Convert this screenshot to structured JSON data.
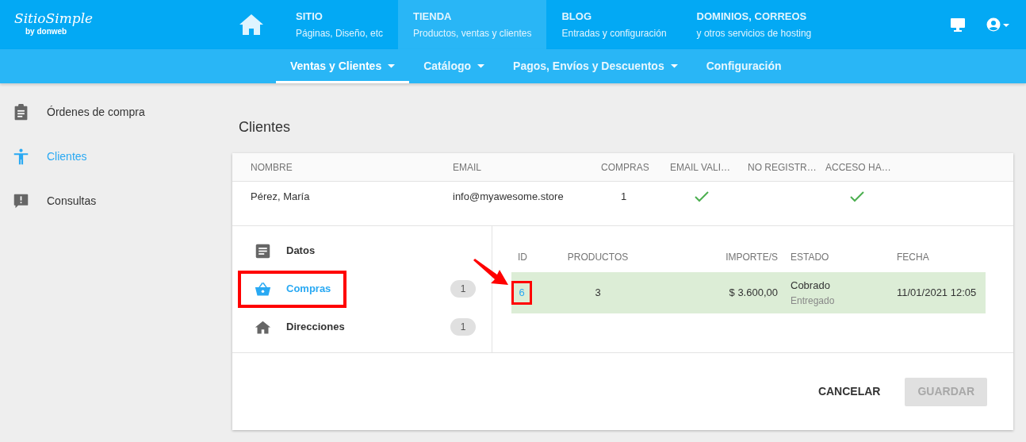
{
  "brand": {
    "name": "SitioSimple",
    "tagline": "by donweb"
  },
  "main_nav": [
    {
      "title": "SITIO",
      "subtitle": "Páginas, Diseño, etc",
      "selected": false
    },
    {
      "title": "TIENDA",
      "subtitle": "Productos, ventas y clientes",
      "selected": true
    },
    {
      "title": "BLOG",
      "subtitle": "Entradas y configuración",
      "selected": false
    },
    {
      "title": "DOMINIOS, CORREOS",
      "subtitle": "y otros servicios de hosting",
      "selected": false
    }
  ],
  "sub_nav": [
    {
      "label": "Ventas y Clientes",
      "dropdown": true,
      "selected": true
    },
    {
      "label": "Catálogo",
      "dropdown": true,
      "selected": false
    },
    {
      "label": "Pagos, Envíos y Descuentos",
      "dropdown": true,
      "selected": false
    },
    {
      "label": "Configuración",
      "dropdown": false,
      "selected": false
    }
  ],
  "sidebar": {
    "items": [
      {
        "label": "Órdenes de compra",
        "selected": false
      },
      {
        "label": "Clientes",
        "selected": true
      },
      {
        "label": "Consultas",
        "selected": false
      }
    ]
  },
  "page_title": "Clientes",
  "customers_table": {
    "columns": [
      "NOMBRE",
      "EMAIL",
      "COMPRAS",
      "EMAIL VALI…",
      "NO REGISTR…",
      "ACCESO HA…"
    ],
    "rows": [
      {
        "nombre": "Pérez, María",
        "email": "info@myawesome.store",
        "compras": "1",
        "email_validado": true,
        "no_registrado": false,
        "acceso_habilitado": true
      }
    ]
  },
  "detail_tabs": [
    {
      "label": "Datos",
      "selected": false,
      "highlighted": false
    },
    {
      "label": "Compras",
      "selected": true,
      "highlighted": true,
      "count": "1"
    },
    {
      "label": "Direcciones",
      "selected": false,
      "highlighted": false,
      "count": "1"
    }
  ],
  "orders": {
    "columns": [
      "ID",
      "PRODUCTOS",
      "IMPORTE/S",
      "ESTADO",
      "FECHA"
    ],
    "rows": [
      {
        "id": "6",
        "productos": "3",
        "importe": "$ 3.600,00",
        "estado": "Cobrado",
        "entrega": "Entregado",
        "fecha": "11/01/2021 12:05",
        "highlighted": true
      }
    ]
  },
  "buttons": [
    {
      "label": "CANCELAR",
      "disabled": false
    },
    {
      "label": "GUARDAR",
      "disabled": true
    }
  ]
}
